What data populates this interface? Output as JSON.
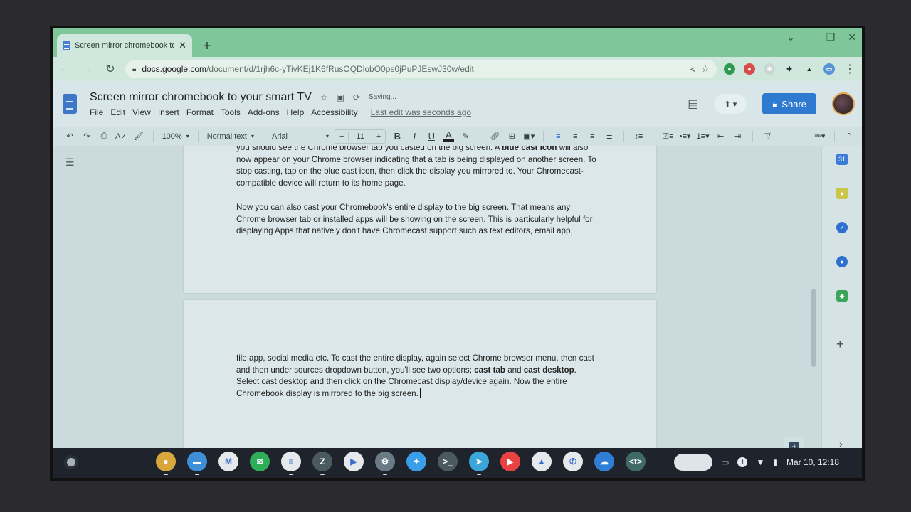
{
  "browser": {
    "tab_title": "Screen mirror chromebook to yo",
    "new_tab_label": "+",
    "window_controls": [
      "⌄",
      "–",
      "❐",
      "✕"
    ],
    "url_host": "docs.google.com",
    "url_path": "/document/d/1rjh6c-yTivKEj1K6fRusOQDlobO0ps0jPuPJEswJ30w/edit",
    "extensions": [
      {
        "name": "pushbullet",
        "glyph": "●",
        "color": "#2e9a4f"
      },
      {
        "name": "todoist",
        "glyph": "●",
        "color": "#d94a4a"
      },
      {
        "name": "ext-faded",
        "glyph": "✱",
        "color": "#c9d6d2"
      },
      {
        "name": "extensions-puzzle",
        "glyph": "✚",
        "color": "#1f2a2a"
      },
      {
        "name": "labs-flask",
        "glyph": "▲",
        "color": "#1f2a2a"
      },
      {
        "name": "cast",
        "glyph": "▭",
        "color": "#5a93d6"
      }
    ]
  },
  "docs": {
    "title": "Screen mirror chromebook to your smart TV",
    "status": "Saving...",
    "menu": [
      "File",
      "Edit",
      "View",
      "Insert",
      "Format",
      "Tools",
      "Add-ons",
      "Help",
      "Accessibility"
    ],
    "last_edit": "Last edit was seconds ago",
    "share_label": "Share",
    "toolbar": {
      "zoom": "100%",
      "style": "Normal text",
      "font": "Arial",
      "font_size": "11",
      "minus": "−",
      "plus": "+",
      "bold": "B",
      "italic": "I",
      "underline": "U",
      "text_color": "A"
    }
  },
  "document": {
    "para1_a": "you should see the Chrome browser tab you casted on the big screen. A ",
    "para1_bold": "blue cast icon",
    "para1_b": " will also now appear on your Chrome browser indicating that a tab is being displayed on another screen. To stop casting, tap on the blue cast icon, then click the display you mirrored to. Your Chromecast-compatible device will return to its home page.",
    "para2": "Now you can also cast your Chromebook's entire display to the big screen. That means any Chrome browser tab or installed apps will be showing on the screen. This is particularly helpful for displaying Apps that natively don't have Chromecast support such as text editors, email app,",
    "para3_a": "file app, social media etc. To cast the entire display, again select Chrome browser menu, then cast and then under sources dropdown button, you'll see two options; ",
    "para3_bold1": "cast tab",
    "para3_and": " and ",
    "para3_bold2": "cast desktop",
    "para3_b": ". Select cast desktop and then click on the Chromecast display/device again. Now the entire Chromebook display is mirrored to the big screen."
  },
  "side_panel": {
    "apps": [
      {
        "name": "calendar",
        "glyph": "31",
        "color": "#3b7bd8"
      },
      {
        "name": "keep",
        "glyph": "●",
        "color": "#c9c64a"
      },
      {
        "name": "tasks",
        "glyph": "✓",
        "color": "#2f6fd0"
      },
      {
        "name": "contacts",
        "glyph": "●",
        "color": "#2f6fd0"
      },
      {
        "name": "maps",
        "glyph": "◆",
        "color": "#3ba65a"
      }
    ],
    "add": "+",
    "collapse": "›"
  },
  "shelf": {
    "apps": [
      {
        "name": "chrome",
        "glyph": "●",
        "color": "#d8a63a"
      },
      {
        "name": "files",
        "glyph": "▬",
        "color": "#3f8fd8"
      },
      {
        "name": "gmail",
        "glyph": "M",
        "color": "#e6e9ec"
      },
      {
        "name": "spotify",
        "glyph": "≋",
        "color": "#2fae5a"
      },
      {
        "name": "docs",
        "glyph": "≡",
        "color": "#e6e9ec"
      },
      {
        "name": "z-app",
        "glyph": "Z",
        "color": "#4b5a60"
      },
      {
        "name": "play-store",
        "glyph": "▶",
        "color": "#e6e9ec"
      },
      {
        "name": "settings",
        "glyph": "⚙",
        "color": "#6b7b86"
      },
      {
        "name": "twitter",
        "glyph": "✦",
        "color": "#3a9ee8"
      },
      {
        "name": "terminal",
        "glyph": ">_",
        "color": "#4b5a60"
      },
      {
        "name": "telegram",
        "glyph": "➤",
        "color": "#3aa6da"
      },
      {
        "name": "youtube",
        "glyph": "▶",
        "color": "#e84242"
      },
      {
        "name": "drive",
        "glyph": "▲",
        "color": "#e6e9ec"
      },
      {
        "name": "whatsapp",
        "glyph": "✆",
        "color": "#e6e9ec"
      },
      {
        "name": "onedrive",
        "glyph": "☁",
        "color": "#2f7fd6"
      },
      {
        "name": "text-app",
        "glyph": "<t>",
        "color": "#3f6a66"
      }
    ],
    "date_time": "Mar 10, 12:18",
    "notification_count": "1"
  }
}
